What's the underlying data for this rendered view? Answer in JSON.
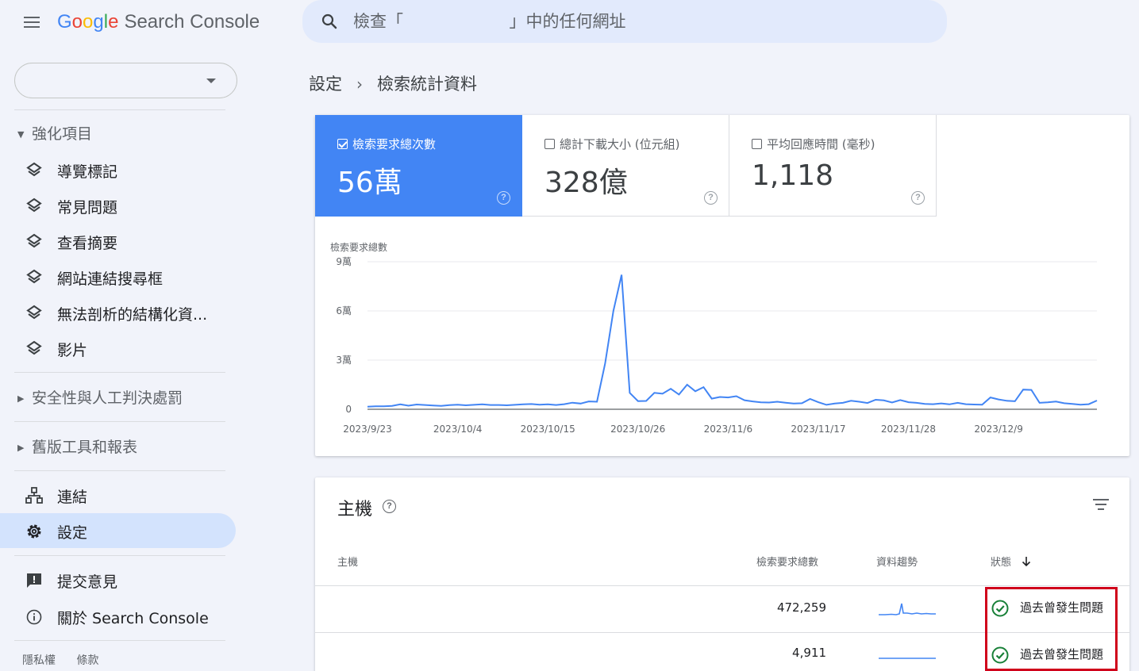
{
  "app": {
    "logo_letters": [
      "G",
      "o",
      "o",
      "g",
      "l",
      "e"
    ],
    "product_name": "Search Console"
  },
  "search": {
    "placeholder": "檢查「                    」中的任何網址"
  },
  "sidebar": {
    "property_selector": "",
    "sections": [
      {
        "label": "強化項目",
        "expanded": true,
        "items": [
          "導覽標記",
          "常見問題",
          "查看摘要",
          "網站連結搜尋框",
          "無法剖析的結構化資...",
          "影片"
        ]
      },
      {
        "label": "安全性與人工判決處罰",
        "expanded": false
      },
      {
        "label": "舊版工具和報表",
        "expanded": false
      }
    ],
    "nav": [
      {
        "label": "連結",
        "icon": "links-icon",
        "active": false
      },
      {
        "label": "設定",
        "icon": "gear-icon",
        "active": true
      }
    ],
    "bottom": [
      {
        "label": "提交意見",
        "icon": "feedback-icon"
      },
      {
        "label": "關於 Search Console",
        "icon": "info-icon"
      }
    ],
    "footer": [
      "隱私權",
      "條款"
    ]
  },
  "breadcrumb": [
    "設定",
    "檢索統計資料"
  ],
  "metrics": [
    {
      "label": "檢索要求總次數",
      "value": "56萬",
      "checked": true
    },
    {
      "label": "總計下載大小 (位元組)",
      "value": "328億",
      "checked": false
    },
    {
      "label": "平均回應時間 (毫秒)",
      "value": "1,118",
      "checked": false
    }
  ],
  "chart_data": {
    "type": "line",
    "title": "檢索要求總數",
    "y_tick_labels": [
      "0",
      "3萬",
      "6萬",
      "9萬"
    ],
    "ylim": [
      0,
      90000
    ],
    "x_tick_labels": [
      "2023/9/23",
      "2023/10/4",
      "2023/10/15",
      "2023/10/26",
      "2023/11/6",
      "2023/11/17",
      "2023/11/28",
      "2023/12/9"
    ],
    "x_range": [
      "2023/9/23",
      "2023/12/18"
    ],
    "series": [
      {
        "color": "#4285f4",
        "values": [
          1600,
          1800,
          1800,
          2100,
          3000,
          2200,
          2900,
          2600,
          2300,
          2100,
          2500,
          2800,
          2400,
          2700,
          3000,
          2600,
          2600,
          2400,
          2700,
          3000,
          3200,
          2800,
          3000,
          2600,
          3100,
          4000,
          3500,
          4800,
          4600,
          28000,
          60000,
          82000,
          10000,
          5000,
          5100,
          10000,
          9500,
          12500,
          9000,
          15000,
          11000,
          13500,
          6500,
          7500,
          7200,
          8000,
          5500,
          4800,
          4200,
          4100,
          4600,
          4000,
          3500,
          3700,
          6300,
          4300,
          2700,
          3500,
          3900,
          5200,
          4600,
          3800,
          5800,
          5400,
          4100,
          5600,
          4300,
          3900,
          3300,
          3100,
          3600,
          3000,
          3900,
          3100,
          2900,
          2800,
          7200,
          6000,
          5200,
          4900,
          12000,
          11800,
          3900,
          4200,
          4700,
          3700,
          3300,
          2800,
          3100,
          5300
        ]
      }
    ],
    "grid": true
  },
  "hosts": {
    "title": "主機",
    "columns": [
      "主機",
      "檢索要求總數",
      "資料趨勢",
      "狀態"
    ],
    "sort_column": "狀態",
    "rows": [
      {
        "host": "",
        "requests": "472,259",
        "status": "過去曾發生問題"
      },
      {
        "host": "",
        "requests": "4,911",
        "status": "過去曾發生問題"
      }
    ]
  },
  "colors": {
    "accent": "#4285f4",
    "active_nav": "#d3e3fd",
    "ok_green": "#188038",
    "highlight": "#d0021b"
  }
}
